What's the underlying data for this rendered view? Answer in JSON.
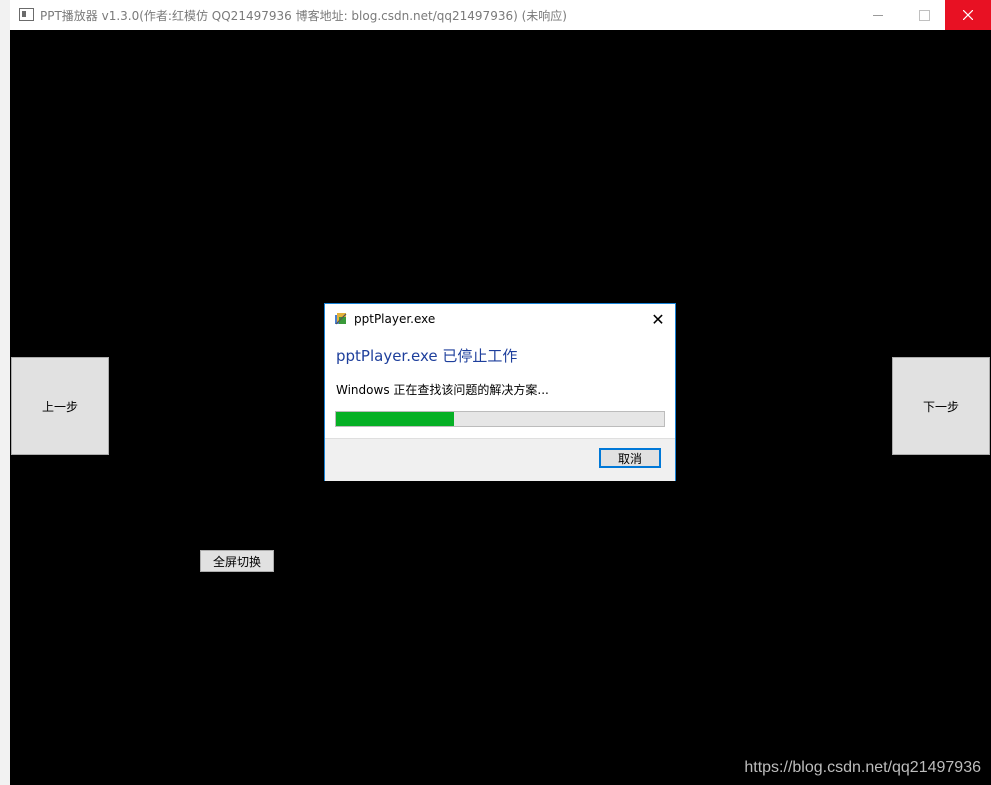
{
  "window": {
    "title": "PPT播放器  v1.3.0(作者:红模仿 QQ21497936 博客地址: blog.csdn.net/qq21497936) (未响应)"
  },
  "player": {
    "prev_label": "上一步",
    "next_label": "下一步",
    "fullscreen_label": "全屏切换"
  },
  "dialog": {
    "title": "pptPlayer.exe",
    "heading": "pptPlayer.exe 已停止工作",
    "status": "Windows 正在查找该问题的解决方案...",
    "progress_percent": 36,
    "cancel_label": "取消",
    "close_glyph": "✕"
  },
  "watermark": "https://blog.csdn.net/qq21497936",
  "colors": {
    "progress_fill": "#06b025",
    "heading": "#1e3f9c",
    "close_button": "#e81123"
  }
}
